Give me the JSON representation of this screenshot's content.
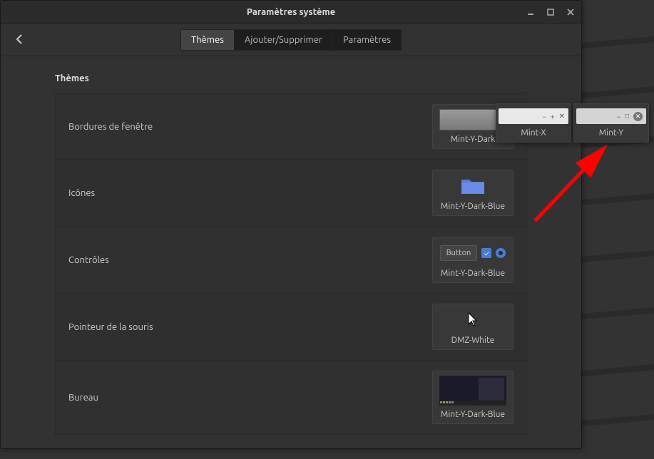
{
  "window": {
    "title": "Paramètres système"
  },
  "tabs": {
    "themes": "Thèmes",
    "add_remove": "Ajouter/Supprimer",
    "settings": "Paramètres"
  },
  "section": {
    "title": "Thèmes"
  },
  "rows": {
    "borders": {
      "label": "Bordures de fenêtre",
      "value": "Mint-Y-Dark"
    },
    "icons": {
      "label": "Icônes",
      "value": "Mint-Y-Dark-Blue"
    },
    "controls": {
      "label": "Contrôles",
      "value": "Mint-Y-Dark-Blue",
      "button_text": "Button"
    },
    "cursor": {
      "label": "Pointeur de la souris",
      "value": "DMZ-White"
    },
    "desktop": {
      "label": "Bureau",
      "value": "Mint-Y-Dark-Blue"
    }
  },
  "popups": {
    "mint_x": "Mint-X",
    "mint_y": "Mint-Y"
  }
}
